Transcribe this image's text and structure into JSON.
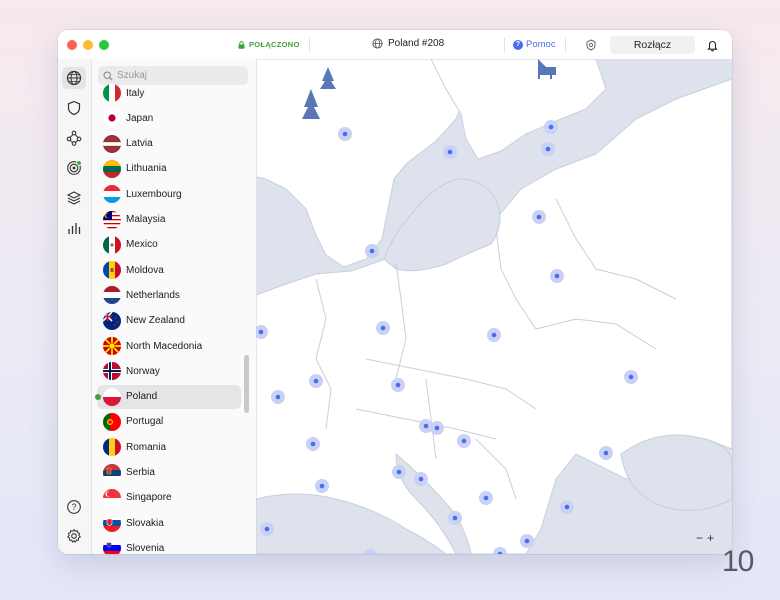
{
  "titlebar": {
    "status": "POŁĄCZONO",
    "server": "Poland #208",
    "help": "Pomoc",
    "disconnect": "Rozłącz"
  },
  "sidebar_icons": [
    "globe-icon",
    "shield-icon",
    "meshnet-icon",
    "target-icon",
    "layers-icon",
    "stats-icon",
    "help-icon",
    "settings-icon"
  ],
  "search": {
    "placeholder": "Szukaj"
  },
  "countries": [
    {
      "name": "Italy",
      "flag": "it"
    },
    {
      "name": "Japan",
      "flag": "jp"
    },
    {
      "name": "Latvia",
      "flag": "lv"
    },
    {
      "name": "Lithuania",
      "flag": "lt"
    },
    {
      "name": "Luxembourg",
      "flag": "lu"
    },
    {
      "name": "Malaysia",
      "flag": "my"
    },
    {
      "name": "Mexico",
      "flag": "mx"
    },
    {
      "name": "Moldova",
      "flag": "md"
    },
    {
      "name": "Netherlands",
      "flag": "nl"
    },
    {
      "name": "New Zealand",
      "flag": "nz"
    },
    {
      "name": "North Macedonia",
      "flag": "mk"
    },
    {
      "name": "Norway",
      "flag": "no"
    },
    {
      "name": "Poland",
      "flag": "pl",
      "selected": true
    },
    {
      "name": "Portugal",
      "flag": "pt"
    },
    {
      "name": "Romania",
      "flag": "ro"
    },
    {
      "name": "Serbia",
      "flag": "rs"
    },
    {
      "name": "Singapore",
      "flag": "sg"
    },
    {
      "name": "Slovakia",
      "flag": "sk"
    },
    {
      "name": "Slovenia",
      "flag": "si"
    }
  ],
  "map": {
    "zoom_out": "−",
    "zoom_in": "+"
  },
  "logo": "10",
  "colors": {
    "accent": "#4a6cf0",
    "connected": "#3da23d",
    "sea": "#dde2ec",
    "land": "#ffffff"
  }
}
